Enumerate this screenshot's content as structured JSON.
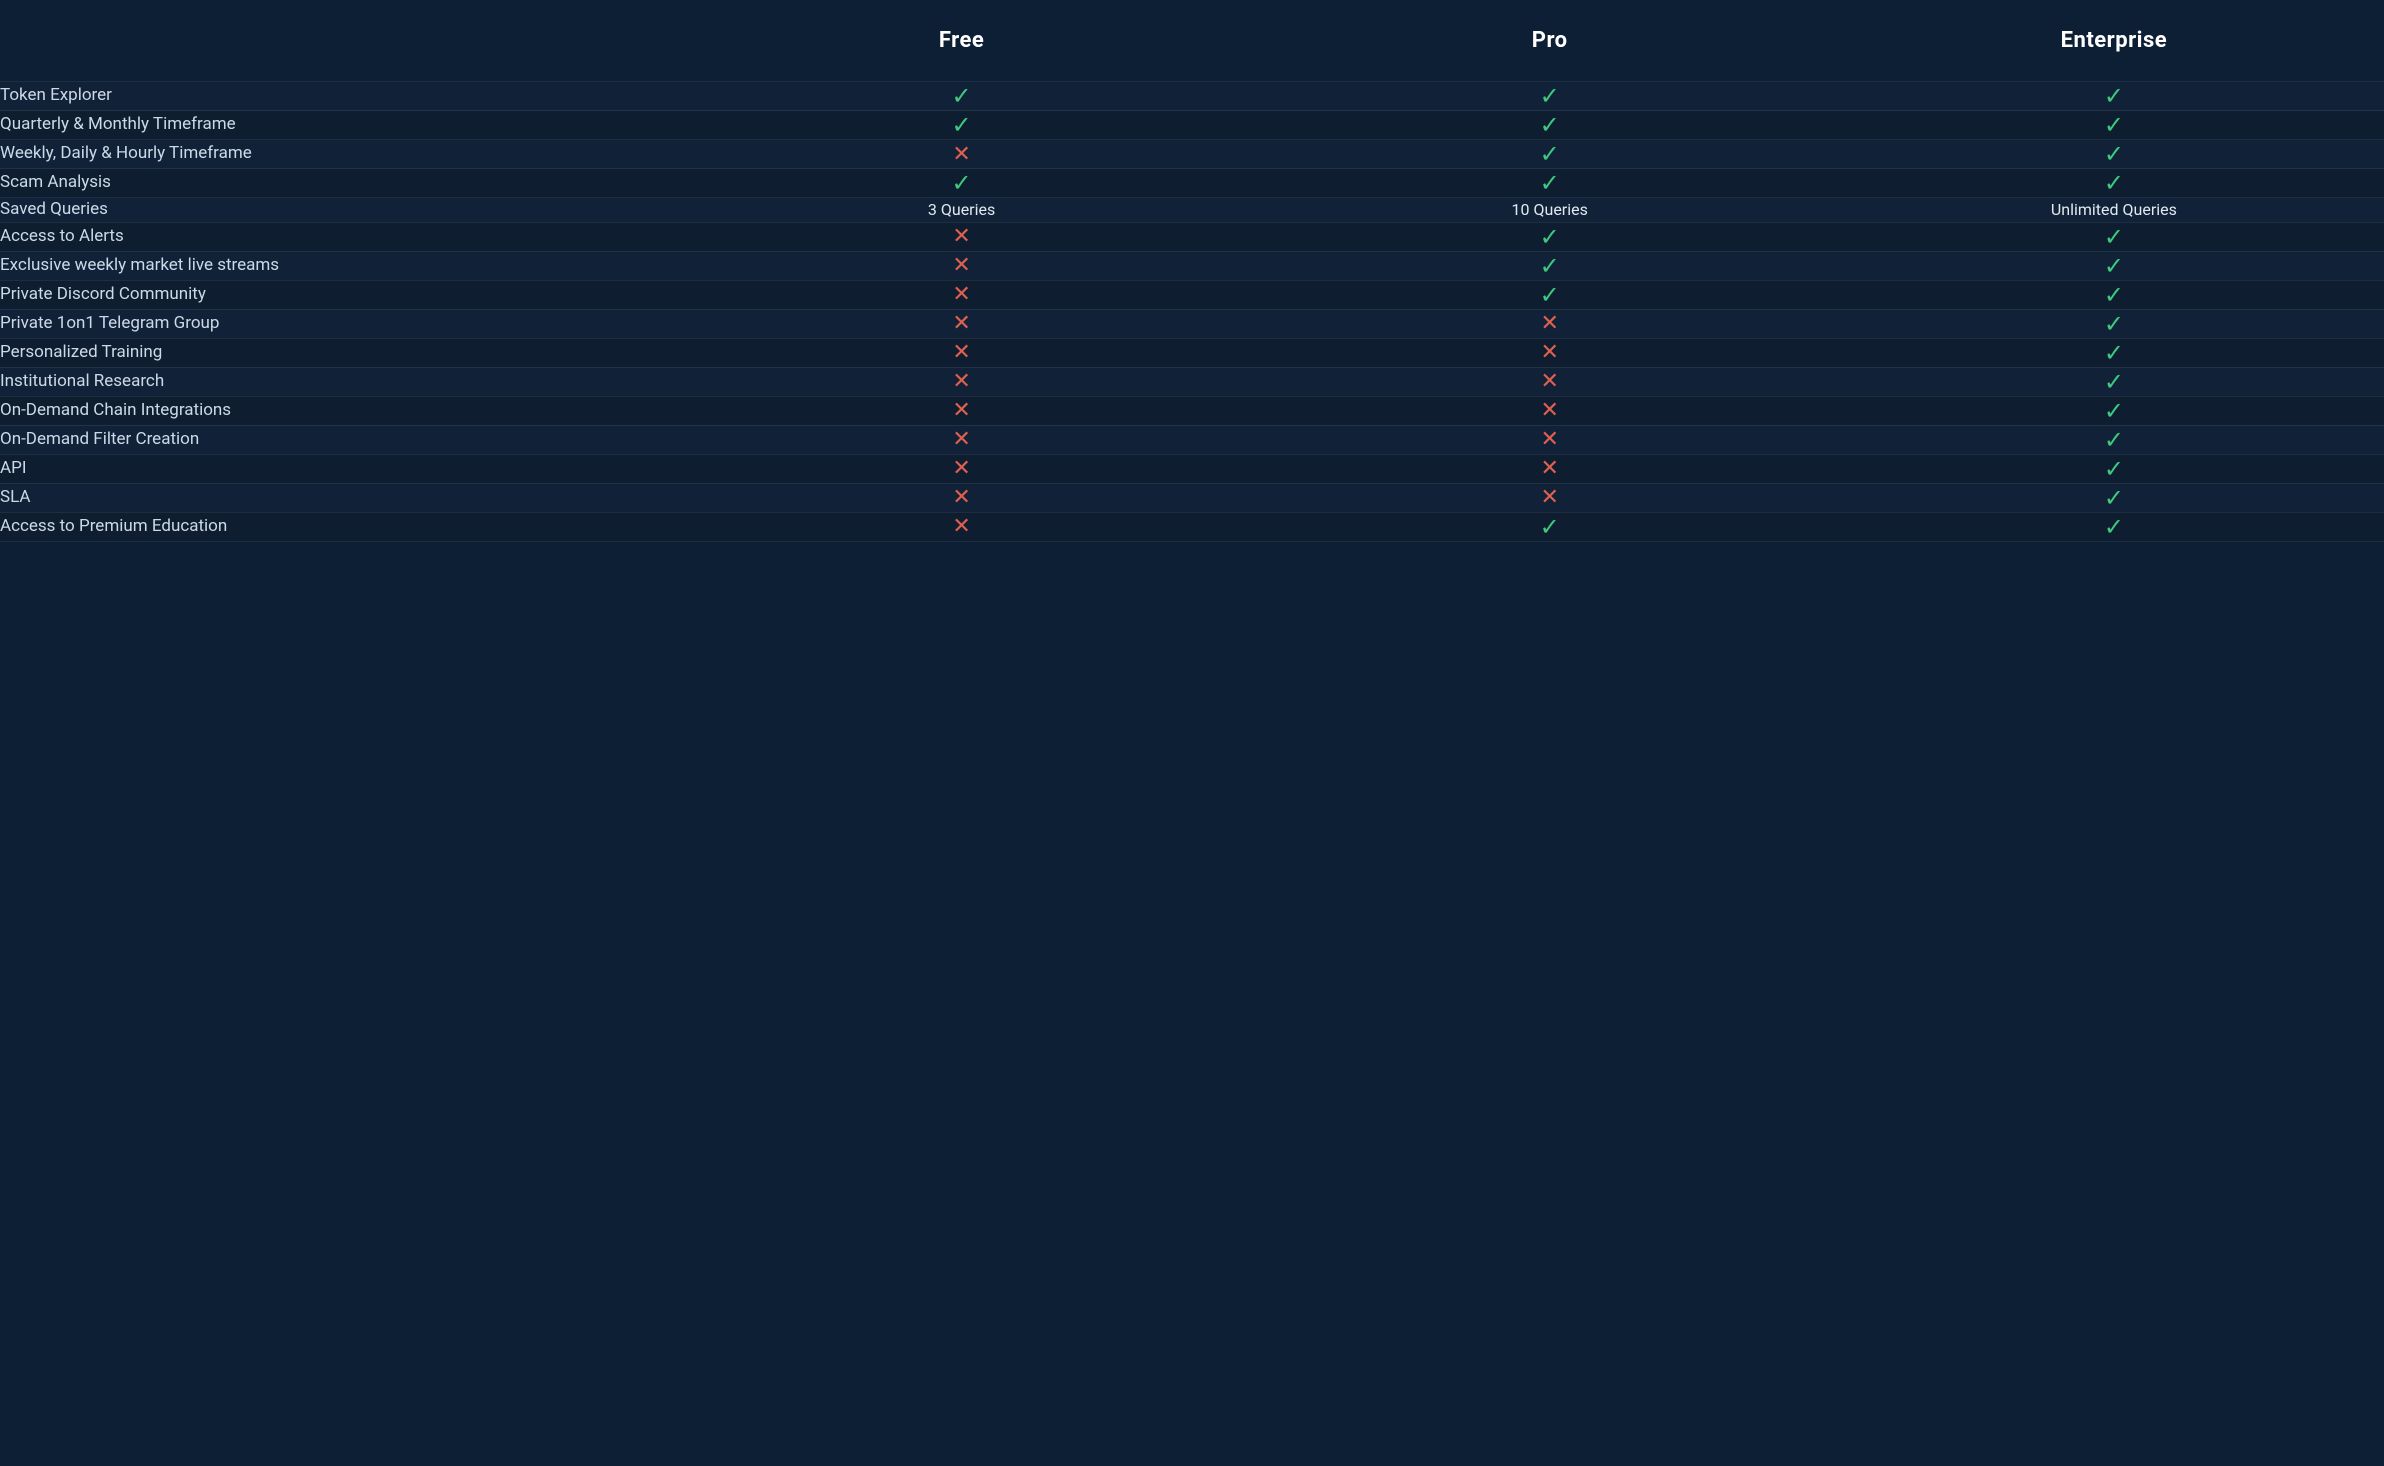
{
  "table": {
    "columns": [
      {
        "key": "feature",
        "label": ""
      },
      {
        "key": "free",
        "label": "Free"
      },
      {
        "key": "pro",
        "label": "Pro"
      },
      {
        "key": "enterprise",
        "label": "Enterprise"
      }
    ],
    "rows": [
      {
        "feature": "Token Explorer",
        "free": "check",
        "pro": "check",
        "enterprise": "check"
      },
      {
        "feature": "Quarterly & Monthly Timeframe",
        "free": "check",
        "pro": "check",
        "enterprise": "check"
      },
      {
        "feature": "Weekly, Daily & Hourly Timeframe",
        "free": "cross",
        "pro": "check",
        "enterprise": "check"
      },
      {
        "feature": "Scam Analysis",
        "free": "check",
        "pro": "check",
        "enterprise": "check"
      },
      {
        "feature": "Saved Queries",
        "free": "3 Queries",
        "pro": "10 Queries",
        "enterprise": "Unlimited Queries"
      },
      {
        "feature": "Access to Alerts",
        "free": "cross",
        "pro": "check",
        "enterprise": "check"
      },
      {
        "feature": "Exclusive weekly market live streams",
        "free": "cross",
        "pro": "check",
        "enterprise": "check"
      },
      {
        "feature": "Private Discord Community",
        "free": "cross",
        "pro": "check",
        "enterprise": "check"
      },
      {
        "feature": "Private 1on1 Telegram Group",
        "free": "cross",
        "pro": "cross",
        "enterprise": "check"
      },
      {
        "feature": "Personalized Training",
        "free": "cross",
        "pro": "cross",
        "enterprise": "check"
      },
      {
        "feature": "Institutional Research",
        "free": "cross",
        "pro": "cross",
        "enterprise": "check"
      },
      {
        "feature": "On-Demand Chain Integrations",
        "free": "cross",
        "pro": "cross",
        "enterprise": "check"
      },
      {
        "feature": "On-Demand Filter Creation",
        "free": "cross",
        "pro": "cross",
        "enterprise": "check"
      },
      {
        "feature": "API",
        "free": "cross",
        "pro": "cross",
        "enterprise": "check"
      },
      {
        "feature": "SLA",
        "free": "cross",
        "pro": "cross",
        "enterprise": "check"
      },
      {
        "feature": "Access to Premium Education",
        "free": "cross",
        "pro": "check",
        "enterprise": "check"
      }
    ],
    "check_symbol": "✓",
    "cross_symbol": "✕"
  }
}
